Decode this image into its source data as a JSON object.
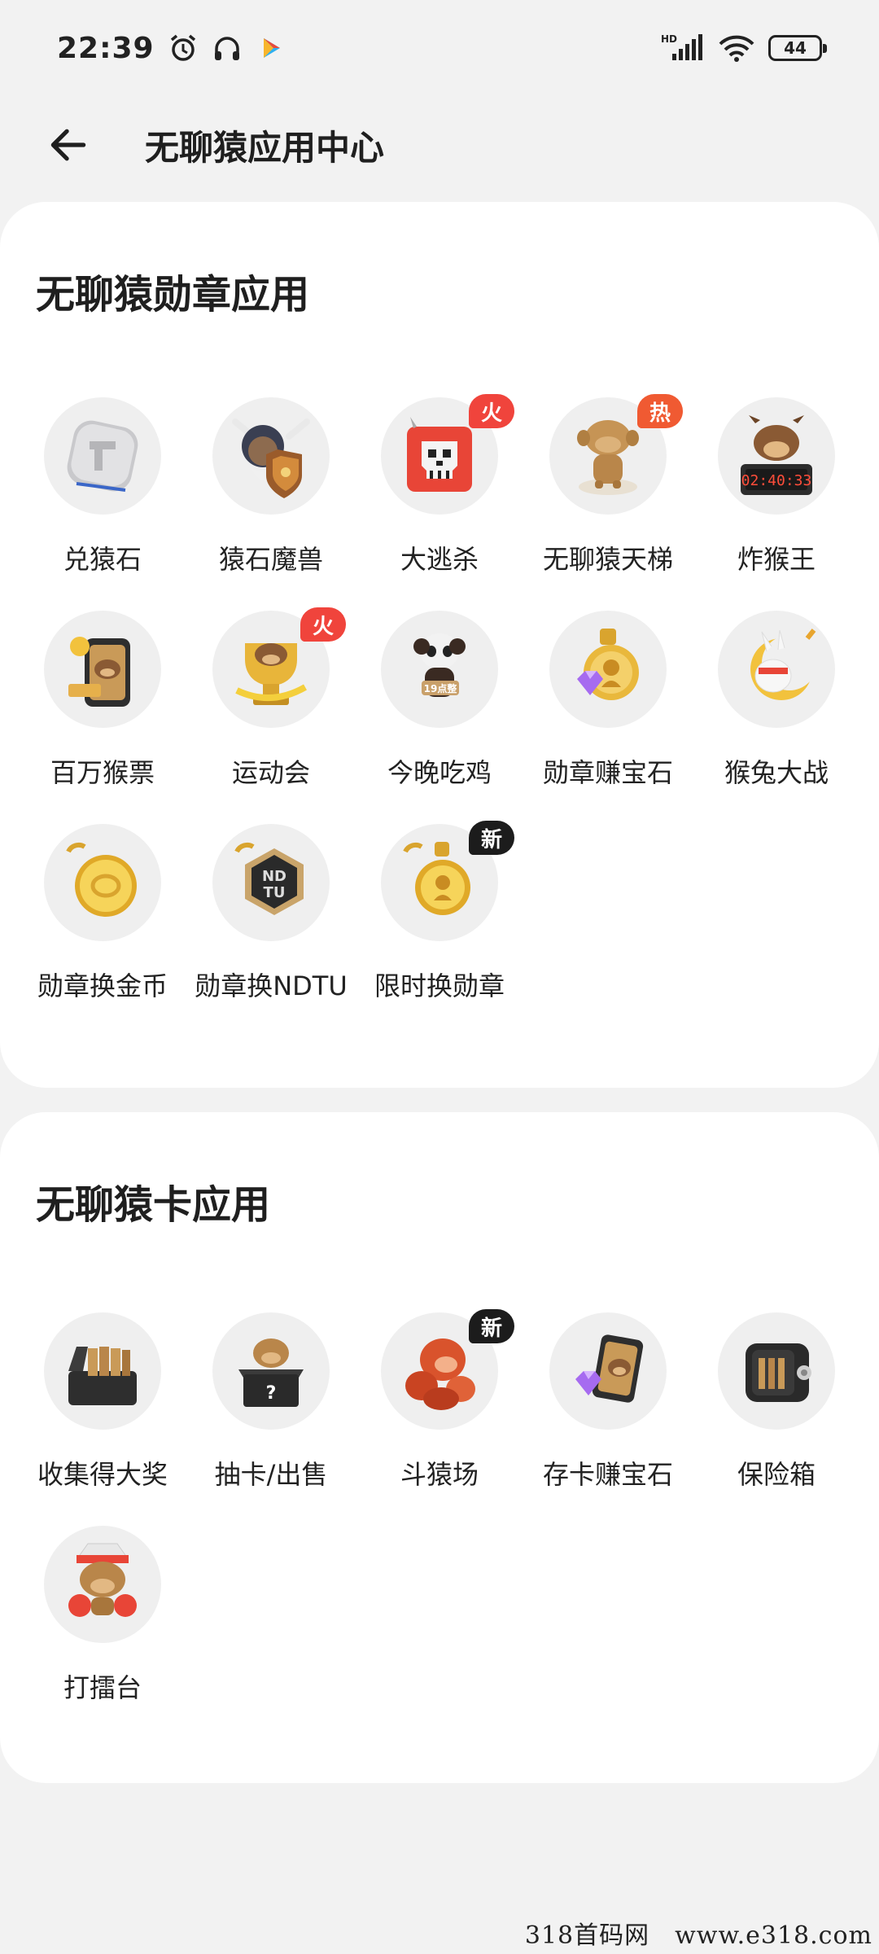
{
  "status_bar": {
    "time": "22:39",
    "battery": "44",
    "network": "HD",
    "icons": [
      "alarm-icon",
      "headphones-icon",
      "play-store-icon",
      "signal-icon",
      "wifi-icon",
      "battery-icon"
    ]
  },
  "header": {
    "title": "无聊猿应用中心",
    "back_icon": "arrow-left-icon"
  },
  "sections": [
    {
      "title": "无聊猿勋章应用",
      "apps": [
        {
          "label": "兑猿石",
          "icon": "stone-token-icon",
          "tag": ""
        },
        {
          "label": "猿石魔兽",
          "icon": "warrior-shield-icon",
          "tag": ""
        },
        {
          "label": "大逃杀",
          "icon": "skull-cube-icon",
          "tag": "火"
        },
        {
          "label": "无聊猿天梯",
          "icon": "monkey-statue-icon",
          "tag": "热"
        },
        {
          "label": "炸猴王",
          "icon": "monkey-bomb-icon",
          "tag": ""
        },
        {
          "label": "百万猴票",
          "icon": "ticket-phone-icon",
          "tag": ""
        },
        {
          "label": "运动会",
          "icon": "trophy-monkey-icon",
          "tag": "火"
        },
        {
          "label": "今晚吃鸡",
          "icon": "skull-mascot-icon",
          "tag": ""
        },
        {
          "label": "勋章赚宝石",
          "icon": "medal-gem-icon",
          "tag": ""
        },
        {
          "label": "猴兔大战",
          "icon": "rabbit-moon-icon",
          "tag": ""
        },
        {
          "label": "勋章换金币",
          "icon": "gold-coin-icon",
          "tag": ""
        },
        {
          "label": "勋章换NDTU",
          "icon": "ndtu-hexagon-icon",
          "tag": ""
        },
        {
          "label": "限时换勋章",
          "icon": "medal-swap-icon",
          "tag": "新"
        }
      ]
    },
    {
      "title": "无聊猿卡应用",
      "apps": [
        {
          "label": "收集得大奖",
          "icon": "card-box-icon",
          "tag": ""
        },
        {
          "label": "抽卡/出售",
          "icon": "mystery-box-icon",
          "tag": ""
        },
        {
          "label": "斗猿场",
          "icon": "gorilla-fighter-icon",
          "tag": "新"
        },
        {
          "label": "存卡赚宝石",
          "icon": "card-gem-icon",
          "tag": ""
        },
        {
          "label": "保险箱",
          "icon": "safe-icon",
          "tag": ""
        },
        {
          "label": "打擂台",
          "icon": "boxer-monkey-icon",
          "tag": ""
        }
      ]
    }
  ],
  "tag_colors": {
    "火": "#f0443c",
    "热": "#f05a32",
    "新": "#1c1c1c"
  },
  "watermark": "318首码网　www.e318.com"
}
